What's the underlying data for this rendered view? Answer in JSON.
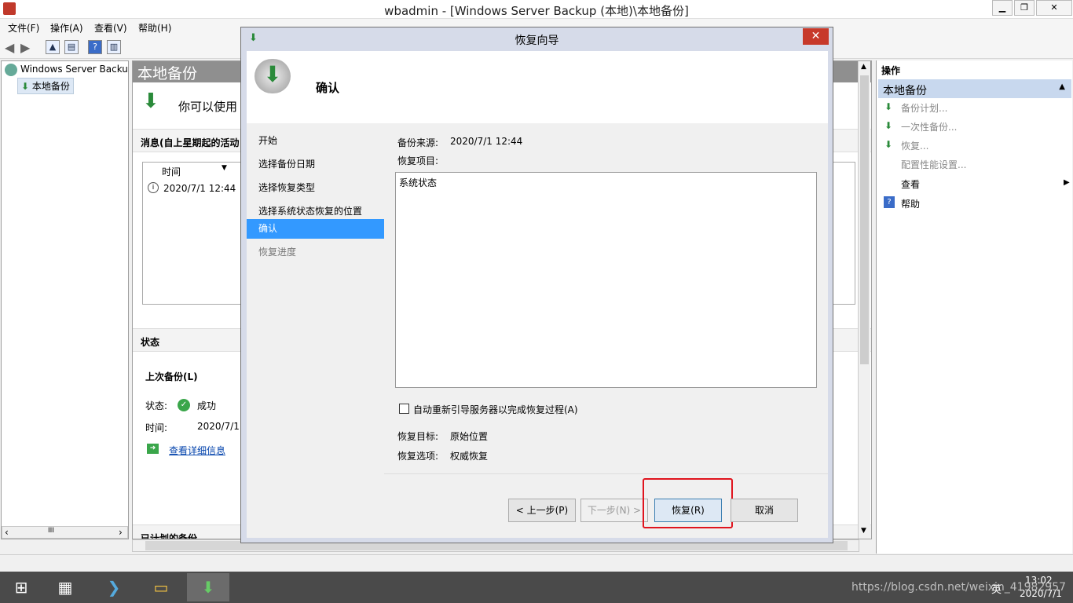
{
  "window": {
    "title": "wbadmin - [Windows Server Backup (本地)\\本地备份]",
    "min": "▁",
    "restore": "❐",
    "close": "✕"
  },
  "menu": [
    "文件(F)",
    "操作(A)",
    "查看(V)",
    "帮助(H)"
  ],
  "tree": {
    "root": "Windows Server Backup",
    "child": "本地备份",
    "scroll_mid": "III"
  },
  "center": {
    "header": "本地备份",
    "intro": "你可以使用",
    "messages_header": "消息(自上星期起的活动",
    "col_time": "时间",
    "row_time": "2020/7/1 12:44",
    "status_header": "状态",
    "last_backup": "上次备份(L)",
    "status_label": "状态:",
    "status_value": "成功",
    "time_label": "时间:",
    "time_value": "2020/7/1",
    "details_link": "查看详细信息",
    "scheduled_header": "已计划的备份"
  },
  "actions": {
    "header": "操作",
    "section": "本地备份",
    "items": [
      "备份计划...",
      "一次性备份...",
      "恢复...",
      "配置性能设置..."
    ],
    "view": "查看",
    "help": "帮助"
  },
  "dialog": {
    "title": "恢复向导",
    "close": "✕",
    "page_title": "确认",
    "nav": [
      "开始",
      "选择备份日期",
      "选择恢复类型",
      "选择系统状态恢复的位置",
      "确认",
      "恢复进度"
    ],
    "source_label": "备份来源:",
    "source_value": "2020/7/1 12:44",
    "items_label": "恢复项目:",
    "items_value": "系统状态",
    "reboot_checkbox": "自动重新引导服务器以完成恢复过程(A)",
    "target_label": "恢复目标:",
    "target_value": "原始位置",
    "options_label": "恢复选项:",
    "options_value": "权威恢复",
    "btn_back": "< 上一步(P)",
    "btn_next": "下一步(N) >",
    "btn_recover": "恢复(R)",
    "btn_cancel": "取消"
  },
  "tray": {
    "time": "13:02",
    "date": "2020/7/1",
    "ime": "英",
    "watermark": "https://blog.csdn.net/weixin_41982957"
  },
  "colors": {
    "nav_selected": "#3399ff",
    "highlight_box": "#e0141e",
    "taskbar": "#4a4a4a"
  }
}
